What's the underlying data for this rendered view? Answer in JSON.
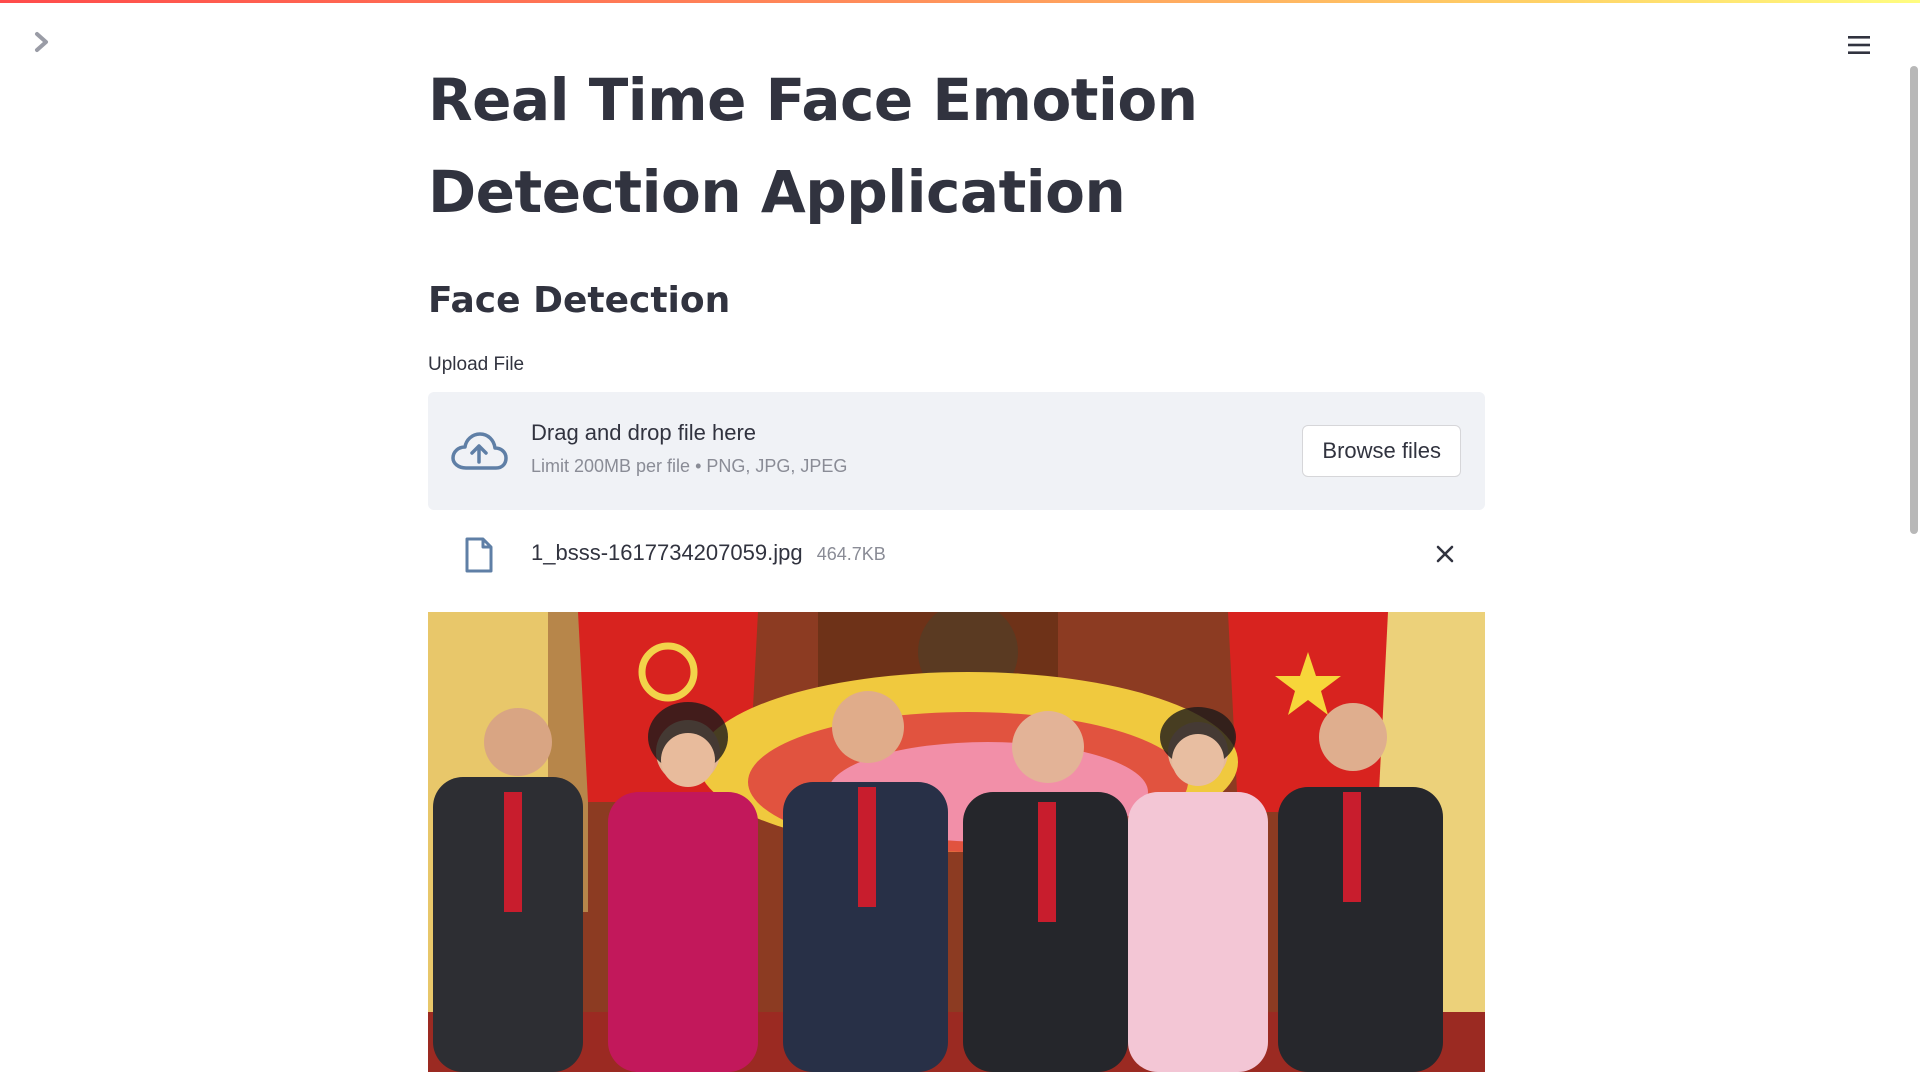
{
  "app": {
    "title": "Real Time Face Emotion Detection Application",
    "accent_gradient": [
      "#ff4b4b",
      "#ffd166",
      "#fffd80"
    ]
  },
  "header": {
    "sidebar_toggle_icon": "chevron-right-icon",
    "menu_icon": "hamburger-menu-icon"
  },
  "main": {
    "subtitle": "Face Detection",
    "uploader": {
      "label": "Upload File",
      "instruction": "Drag and drop file here",
      "limit": "Limit 200MB per file • PNG, JPG, JPEG",
      "browse_label": "Browse files",
      "icon": "cloud-upload-icon"
    },
    "uploaded_file": {
      "name": "1_bsss-1617734207059.jpg",
      "size": "464.7KB",
      "icon": "file-icon",
      "remove_icon": "close-icon"
    },
    "image": {
      "subject": "group-photo"
    }
  }
}
